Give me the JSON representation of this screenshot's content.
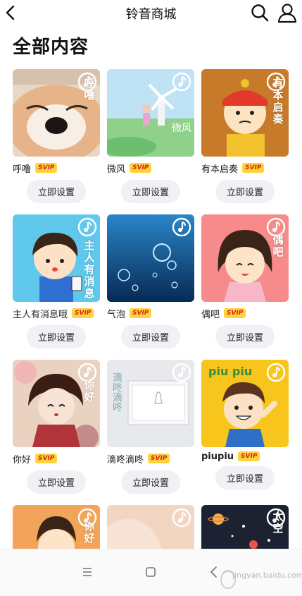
{
  "header": {
    "title": "铃音商城",
    "icons": [
      "back-icon",
      "search-icon",
      "user-icon"
    ]
  },
  "section": {
    "title": "全部内容"
  },
  "badge_label": "SVIP",
  "set_label": "立即设置",
  "colors": {
    "svip_bg": "#ffd43b",
    "svip_text": "#d8231c",
    "button_bg": "#f0f1f4"
  },
  "ringtones": [
    {
      "name": "呼噜",
      "cover_text": "呼噜"
    },
    {
      "name": "微风",
      "cover_text": ""
    },
    {
      "name": "有本启奏",
      "cover_text": "有本启奏"
    },
    {
      "name": "主人有消息哦",
      "cover_text": "主人有消息"
    },
    {
      "name": "气泡",
      "cover_text": ""
    },
    {
      "name": "偶吧",
      "cover_text": "偶吧"
    },
    {
      "name": "你好",
      "cover_text": "你好"
    },
    {
      "name": "滴咚滴咚",
      "cover_text": ""
    },
    {
      "name": "piupiu",
      "cover_text": ""
    }
  ],
  "extra_covers": [
    {
      "cover_text": "你好"
    },
    {
      "cover_text": ""
    },
    {
      "cover_text": "太空"
    }
  ],
  "cover_prints": {
    "weifeng_art": "微风",
    "didong_art": "滴咚滴咚",
    "piupiu_art": "piu piu"
  },
  "navbar": {
    "icons": [
      "menu-icon",
      "home-icon",
      "back-icon"
    ]
  },
  "watermark": {
    "text": "jingyan.baidu.com"
  }
}
